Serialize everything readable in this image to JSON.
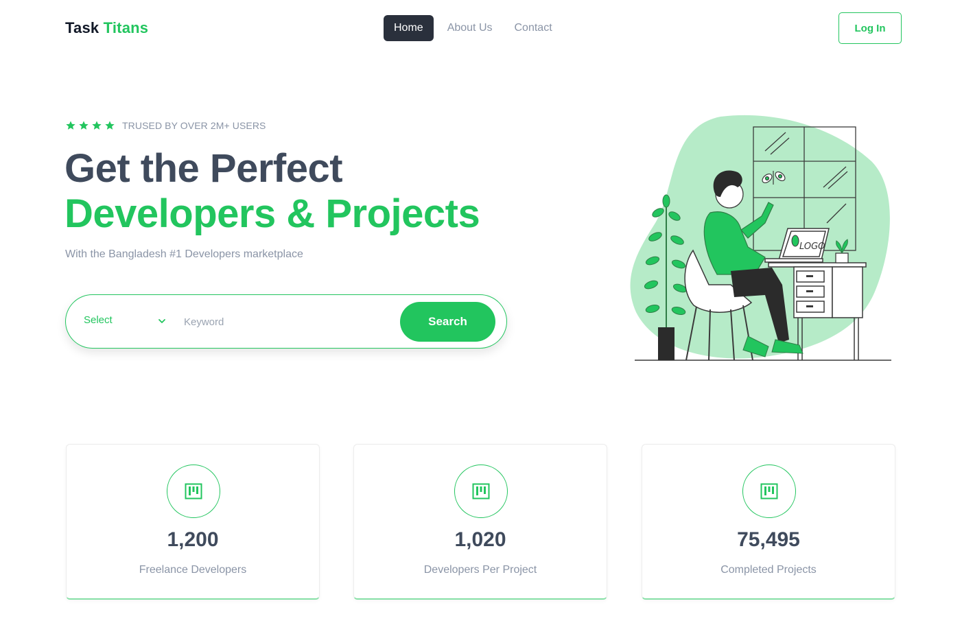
{
  "header": {
    "brand_part1": "Task",
    "brand_part2": "Titans",
    "nav": [
      {
        "label": "Home"
      },
      {
        "label": "About Us"
      },
      {
        "label": "Contact"
      }
    ],
    "login_label": "Log In"
  },
  "hero": {
    "rating_stars": 4,
    "trust_text": "TRUSED BY OVER 2M+ USERS",
    "headline_line1": "Get the Perfect",
    "headline_line2": "Developers & Projects",
    "subtitle": "With the Bangladesh #1 Developers marketplace",
    "search": {
      "select_value": "Select",
      "keyword_placeholder": "Keyword",
      "button_label": "Search"
    }
  },
  "stats": [
    {
      "value": "1,200",
      "label": "Freelance Developers",
      "icon": "kanban-icon"
    },
    {
      "value": "1,020",
      "label": "Developers Per Project",
      "icon": "kanban-icon"
    },
    {
      "value": "75,495",
      "label": "Completed Projects",
      "icon": "kanban-icon"
    }
  ],
  "illustration": {
    "laptop_text": "LOGO"
  },
  "colors": {
    "accent": "#22c55e",
    "dark": "#2a303c",
    "heading": "#3f4a5c",
    "muted": "#8a94a6"
  }
}
